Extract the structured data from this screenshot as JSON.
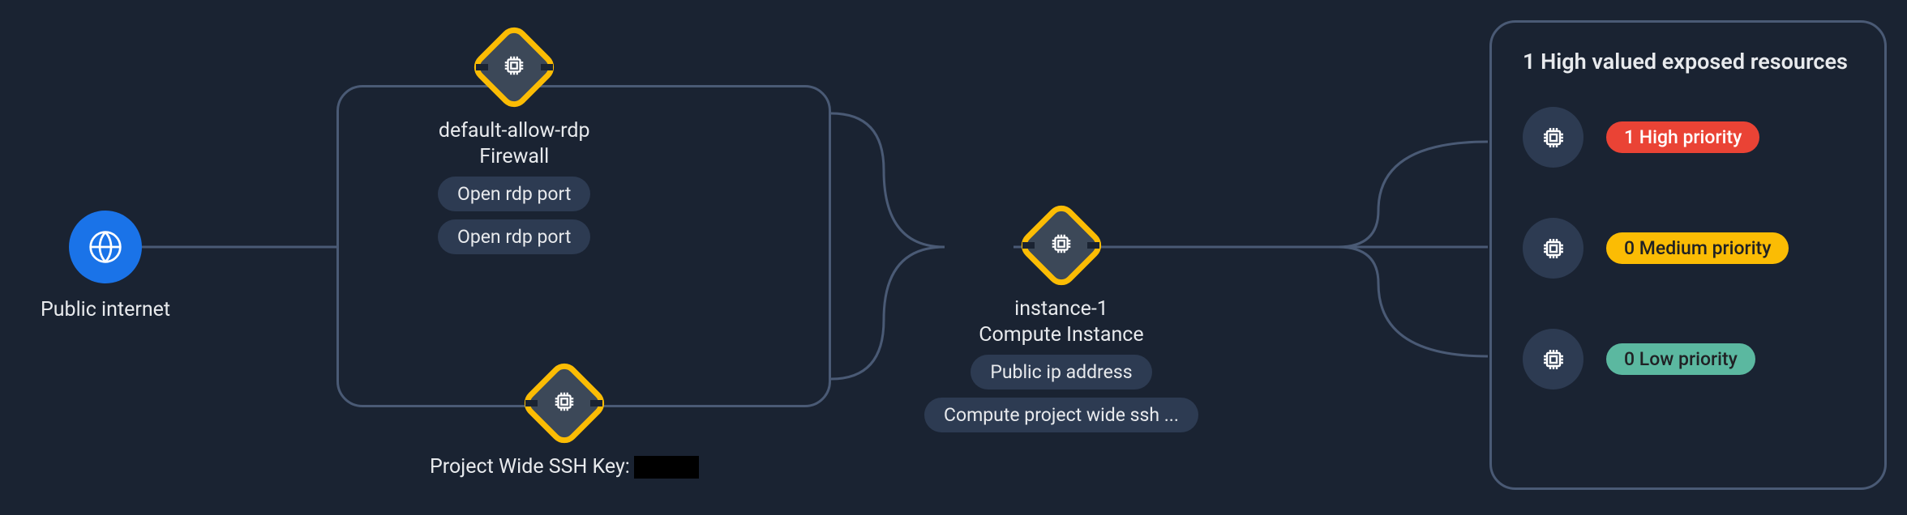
{
  "source": {
    "label": "Public internet"
  },
  "firewall": {
    "title": "default-allow-rdp",
    "subtitle": "Firewall",
    "tags": [
      "Open rdp port",
      "Open rdp port"
    ]
  },
  "ssh": {
    "title": "Project Wide SSH Key:",
    "redacted": true
  },
  "instance": {
    "title": "instance-1",
    "subtitle": "Compute Instance",
    "tags": [
      "Public ip address",
      "Compute project wide ssh ..."
    ]
  },
  "panel": {
    "title": "1 High valued exposed resources",
    "priorities": [
      {
        "label": "1 High priority",
        "level": "high"
      },
      {
        "label": "0 Medium priority",
        "level": "medium"
      },
      {
        "label": "0 Low priority",
        "level": "low"
      }
    ]
  }
}
